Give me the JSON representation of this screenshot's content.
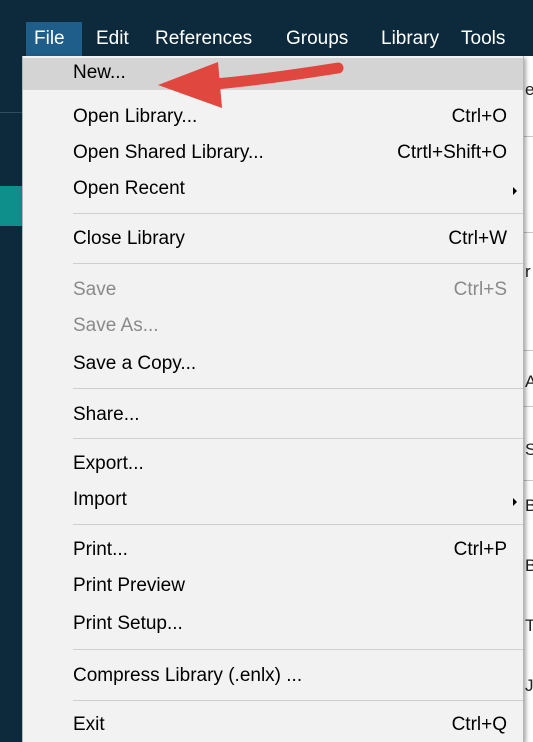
{
  "menubar": {
    "items": [
      {
        "label": "File",
        "active": true
      },
      {
        "label": "Edit"
      },
      {
        "label": "References"
      },
      {
        "label": "Groups"
      },
      {
        "label": "Library"
      },
      {
        "label": "Tools"
      }
    ]
  },
  "file_menu": {
    "items": [
      {
        "label": "New...",
        "shortcut": "",
        "highlighted": true
      },
      {
        "label": "Open Library...",
        "shortcut": "Ctrl+O"
      },
      {
        "label": "Open Shared Library...",
        "shortcut": "Ctrtl+Shift+O"
      },
      {
        "label": "Open Recent",
        "shortcut": "",
        "submenu": true
      },
      {
        "label": "Close Library",
        "shortcut": "Ctrl+W"
      },
      {
        "label": "Save",
        "shortcut": "Ctrl+S",
        "disabled": true
      },
      {
        "label": "Save As...",
        "shortcut": "",
        "disabled": true
      },
      {
        "label": "Save a Copy...",
        "shortcut": ""
      },
      {
        "label": "Share...",
        "shortcut": ""
      },
      {
        "label": "Export...",
        "shortcut": ""
      },
      {
        "label": "Import",
        "shortcut": "",
        "submenu": true
      },
      {
        "label": "Print...",
        "shortcut": "Ctrl+P"
      },
      {
        "label": "Print Preview",
        "shortcut": ""
      },
      {
        "label": "Print Setup...",
        "shortcut": ""
      },
      {
        "label": "Compress Library (.enlx) ...",
        "shortcut": ""
      },
      {
        "label": "Exit",
        "shortcut": "Ctrl+Q"
      }
    ]
  },
  "background_peek": {
    "letters": [
      "e",
      "r",
      "A",
      "S",
      "B",
      "B",
      "T",
      "J"
    ]
  },
  "colors": {
    "menubar_bg": "#0d2a3c",
    "menubar_active": "#1f5d8a",
    "dropdown_bg": "#f2f2f2",
    "highlight": "#d4d4d4",
    "disabled_text": "#8a8a8a",
    "teal_accent": "#0e8f8c",
    "annotation_arrow": "#e0473e"
  },
  "annotation": {
    "icon": "red-arrow-icon"
  }
}
